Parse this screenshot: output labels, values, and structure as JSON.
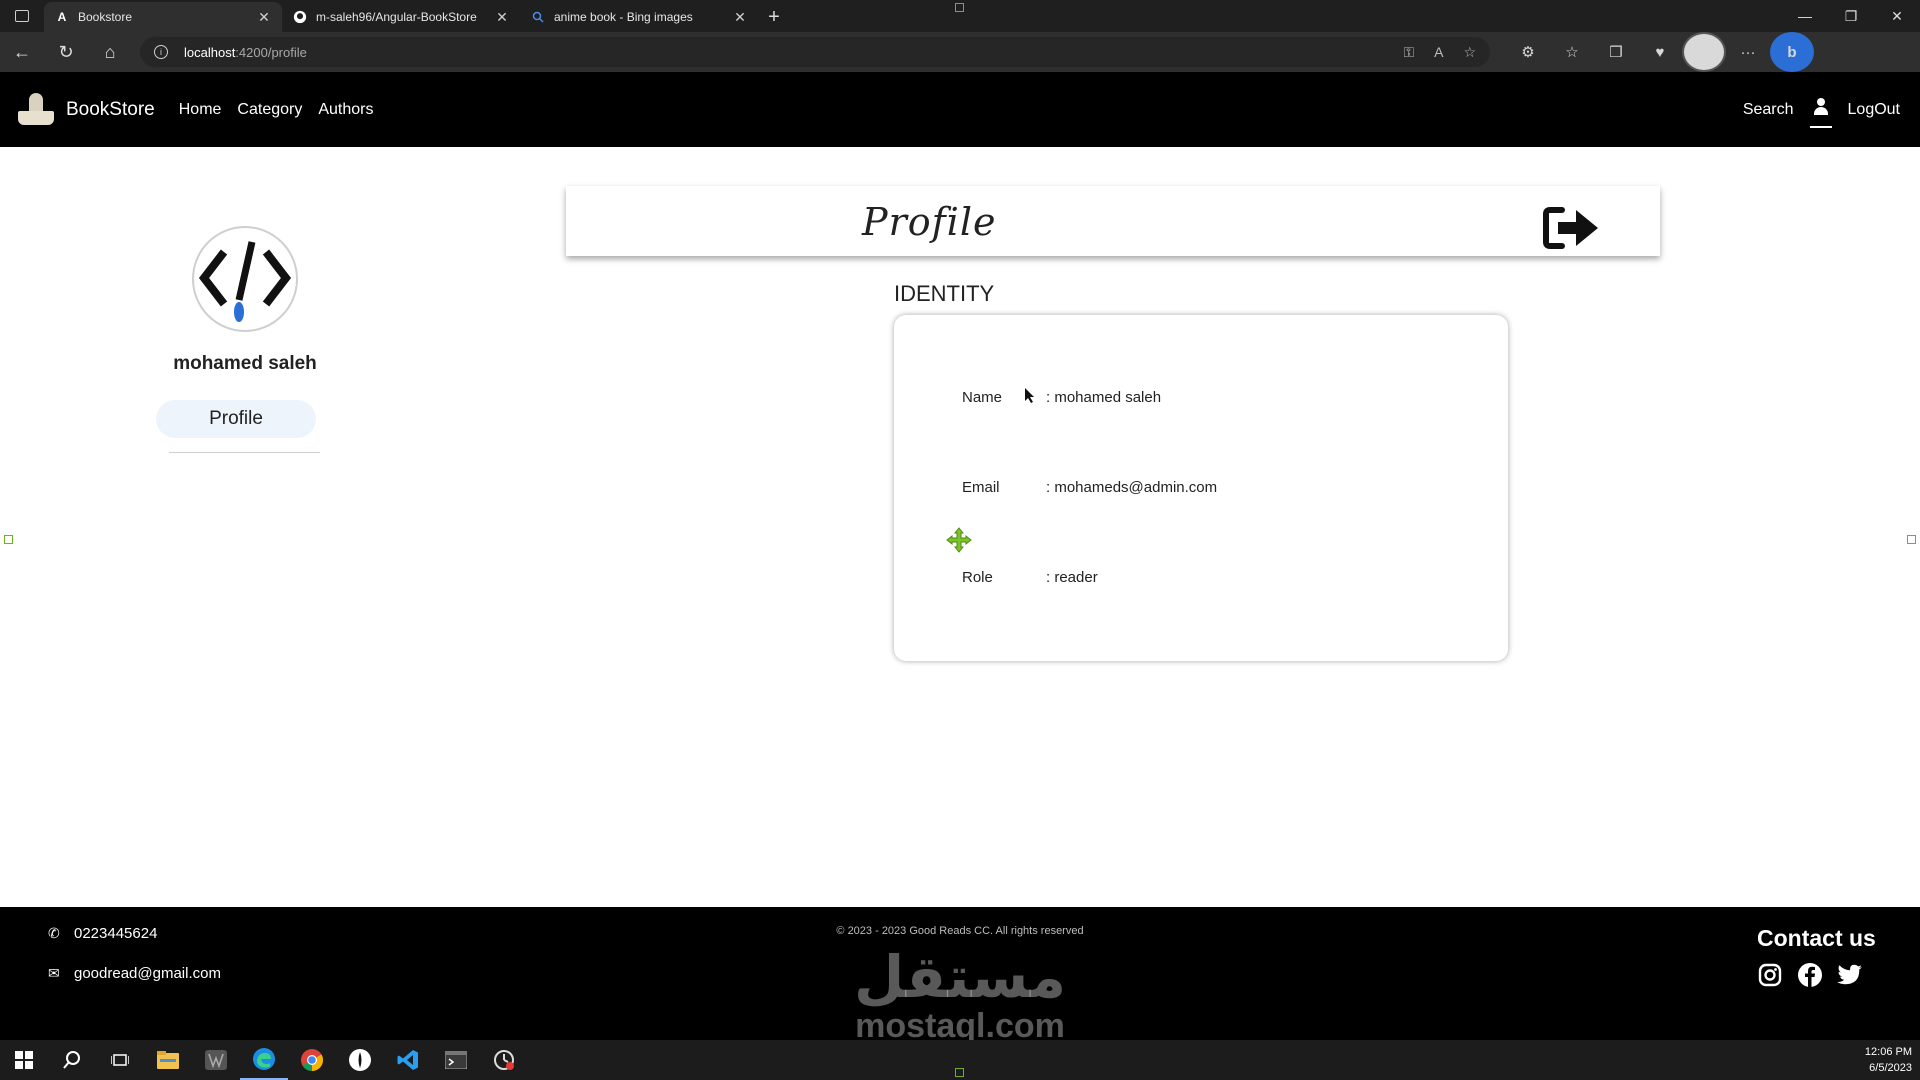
{
  "browser": {
    "tabs": [
      {
        "title": "Bookstore",
        "favicon": "angular-icon",
        "active": true
      },
      {
        "title": "m-saleh96/Angular-BookStore",
        "favicon": "github-icon",
        "active": false
      },
      {
        "title": "anime book - Bing images",
        "favicon": "search-icon",
        "active": false
      }
    ],
    "url_host": "localhost",
    "url_path": ":4200/profile"
  },
  "navbar": {
    "brand": "BookStore",
    "links": [
      "Home",
      "Category",
      "Authors"
    ],
    "search": "Search",
    "logout": "LogOut"
  },
  "sidebar": {
    "username": "mohamed saleh",
    "profile_button": "Profile"
  },
  "main": {
    "header_title": "Profile",
    "identity_title": "IDENTITY",
    "fields": [
      {
        "label": "Name",
        "value": ": mohamed saleh"
      },
      {
        "label": "Email",
        "value": ": mohameds@admin.com"
      },
      {
        "label": "Role",
        "value": ": reader"
      }
    ]
  },
  "footer": {
    "phone": "0223445624",
    "email": "goodread@gmail.com",
    "copyright": "© 2023 - 2023 Good Reads CC. All rights reserved",
    "contact_title": "Contact us",
    "social": [
      "instagram-icon",
      "facebook-icon",
      "twitter-icon"
    ],
    "watermark_arabic": "مستقل",
    "watermark_latin": "mostaql.com"
  },
  "taskbar": {
    "time": "12:06 PM",
    "date": "6/5/2023"
  },
  "colors": {
    "navbar_bg": "#000000",
    "profile_pill_bg": "#eef4fb",
    "selection_handle": "#6cb31d"
  }
}
